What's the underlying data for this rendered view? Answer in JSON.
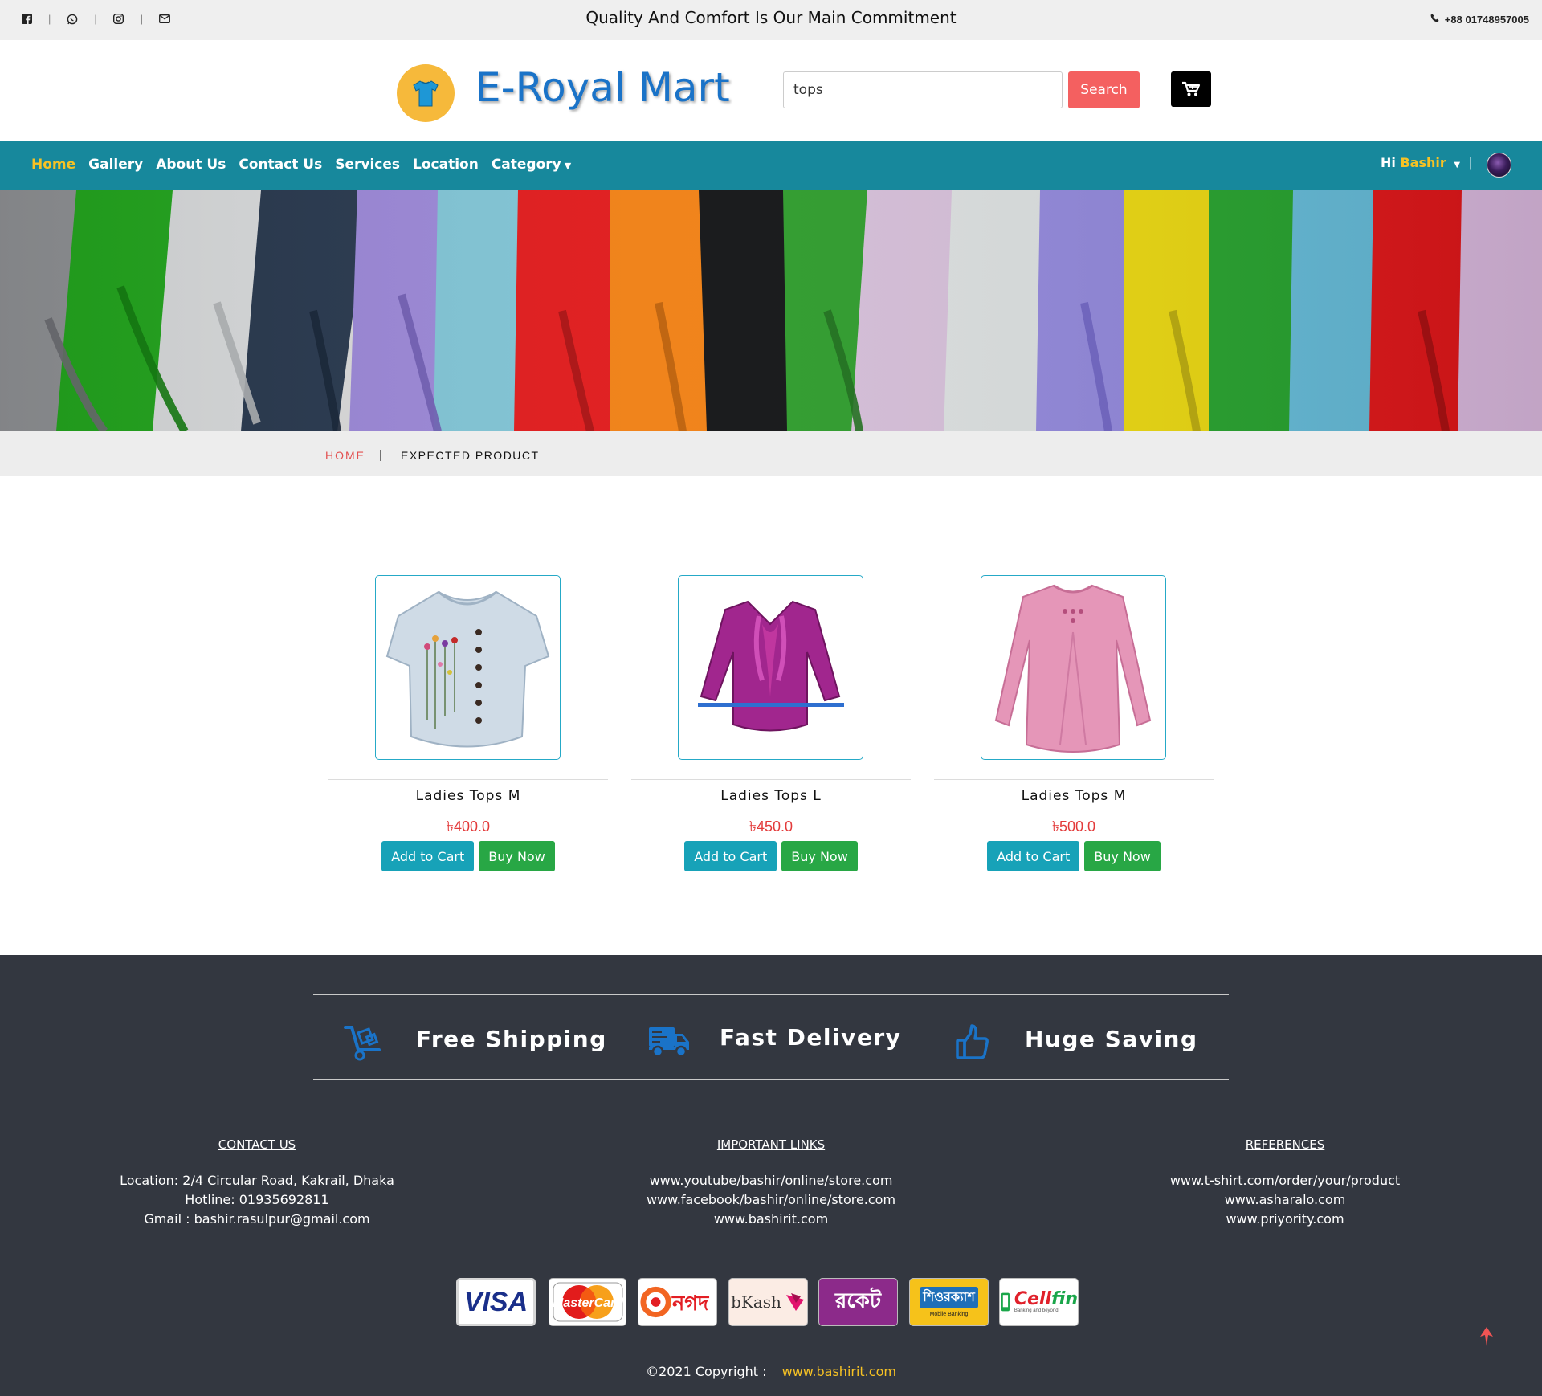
{
  "topbar": {
    "tagline": "Quality And Comfort Is Our Main Commitment",
    "phone": "+88 01748957005",
    "social_icons": [
      "facebook-icon",
      "whatsapp-icon",
      "instagram-icon",
      "email-icon"
    ]
  },
  "header": {
    "brand_name": "E-Royal Mart",
    "search_value": "tops",
    "search_button": "Search"
  },
  "nav": {
    "items": [
      "Home",
      "Gallery",
      "About Us",
      "Contact Us",
      "Services",
      "Location",
      "Category"
    ],
    "greeting_prefix": "Hi",
    "user_name": "Bashir",
    "separator": "|"
  },
  "breadcrumb": {
    "home": "HOME",
    "separator": "|",
    "current": "EXPECTED PRODUCT"
  },
  "products": [
    {
      "name": "Ladies Tops M",
      "price": "৳400.0",
      "add_label": "Add to Cart",
      "buy_label": "Buy Now"
    },
    {
      "name": "Ladies Tops L",
      "price": "৳450.0",
      "add_label": "Add to Cart",
      "buy_label": "Buy Now"
    },
    {
      "name": "Ladies Tops M",
      "price": "৳500.0",
      "add_label": "Add to Cart",
      "buy_label": "Buy Now"
    }
  ],
  "features": [
    {
      "title": "Free Shipping",
      "icon": "cart-dolly-icon"
    },
    {
      "title": "Fast Delivery",
      "icon": "truck-icon"
    },
    {
      "title": "Huge Saving",
      "icon": "thumbs-up-icon"
    }
  ],
  "footer": {
    "contact": {
      "heading": "CONTACT US",
      "lines": [
        "Location: 2/4 Circular Road, Kakrail, Dhaka",
        "Hotline: 01935692811",
        "Gmail : bashir.rasulpur@gmail.com"
      ]
    },
    "links": {
      "heading": "IMPORTANT LINKS",
      "lines": [
        "www.youtube/bashir/online/store.com",
        "www.facebook/bashir/online/store.com",
        "www.bashirit.com"
      ]
    },
    "references": {
      "heading": "REFERENCES",
      "lines": [
        "www.t-shirt.com/order/your/product",
        "www.asharalo.com",
        "www.priyority.com"
      ]
    },
    "payments": [
      "VISA",
      "MasterCard",
      "নগদ",
      "bKash",
      "রকেট",
      "শিওরক্যাশ",
      "Mobile Banking",
      "Cell",
      "fin",
      "Banking and beyond"
    ],
    "copyright": "©2021 Copyright :",
    "copyright_site": "www.bashirit.com"
  },
  "colors": {
    "nav_bg": "#17889c",
    "accent_yellow": "#f7c224",
    "search_button": "#f46060",
    "add_to_cart": "#17a2b8",
    "buy_now": "#28a745",
    "footer_bg": "#333740",
    "price": "#e33a3a"
  }
}
